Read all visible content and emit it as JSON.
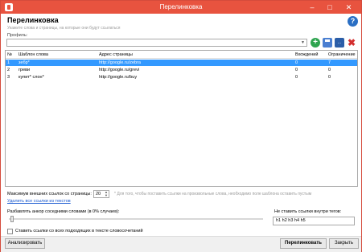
{
  "window": {
    "title": "Перелинковка"
  },
  "header": {
    "title": "Перелинковка",
    "subtitle": "Укажите слова и страницы, на которые они будут ссылаться"
  },
  "profile": {
    "label": "Профиль:",
    "value": ""
  },
  "toolbar": {
    "add_symbol": "+",
    "saveas_text": "...",
    "delete_symbol": "✖"
  },
  "table": {
    "headers": {
      "num": "№",
      "template": "Шаблон слова",
      "url": "Адрес страницы",
      "occurrences": "Вхождений",
      "limit": "Ограничение"
    },
    "rows": [
      {
        "num": "1",
        "template": "зебр*",
        "url": "http://google.ru/zebra",
        "occurrences": "0",
        "limit": "7",
        "selected": true
      },
      {
        "num": "2",
        "template": "греви",
        "url": "http://google.ru/grevi",
        "occurrences": "0",
        "limit": "0",
        "selected": false
      },
      {
        "num": "3",
        "template": "купит* слон*",
        "url": "http://google.ru/buy",
        "occurrences": "0",
        "limit": "0",
        "selected": false
      }
    ]
  },
  "settings": {
    "max_links_label": "Максимум внешних ссылок со страницы:",
    "max_links_value": "20",
    "hint": "* Для того, чтобы поставить ссылки на произвольные слова, необходимо поле шаблона оставить пустым",
    "remove_all_link": "Удалить все ссылки из текстов",
    "split_anchor_label": "Разбавлять анкор соседними словами   (в 0% случаев):",
    "split_anchor_percent": 0,
    "not_inside_label": "Не ставить ссылки внутри тегов:",
    "not_inside_value": "h1 h2 h3 h4 h5",
    "all_matches_label": "Ставить ссылки со всех подходящих в тексте словосочетаний",
    "all_matches_checked": false
  },
  "buttons": {
    "analyze": "Анализировать",
    "link": "Перелинковать",
    "close": "Закрыть"
  }
}
